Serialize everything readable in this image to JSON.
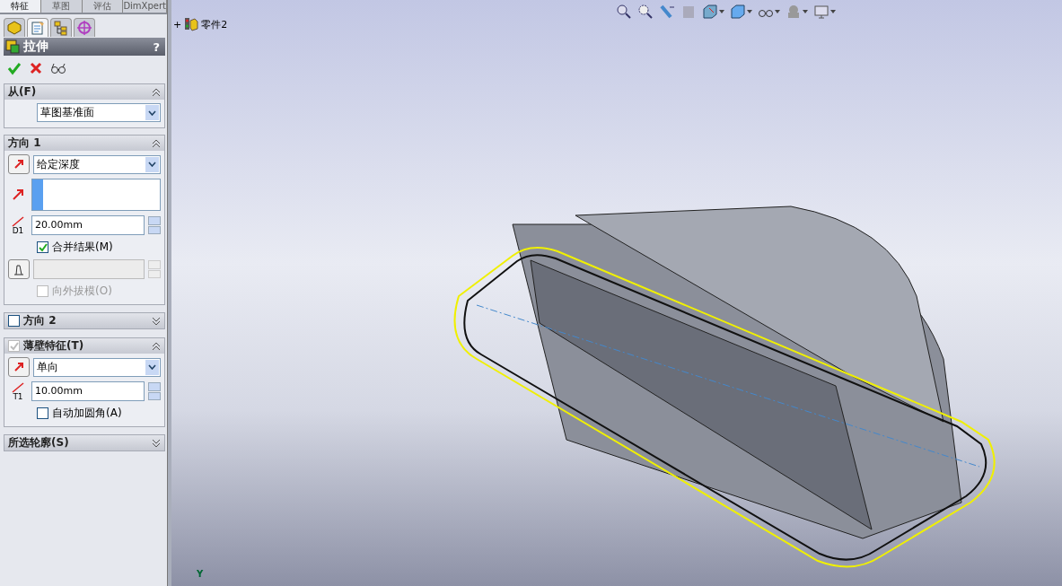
{
  "command_tabs": [
    {
      "label": "特征",
      "selected": true
    },
    {
      "label": "草图",
      "selected": false
    },
    {
      "label": "评估",
      "selected": false
    },
    {
      "label": "DimXpert",
      "selected": false
    }
  ],
  "manager_tabs": [
    {
      "kind": "feature",
      "selected": false
    },
    {
      "kind": "property",
      "selected": true
    },
    {
      "kind": "config",
      "selected": false
    },
    {
      "kind": "display",
      "selected": false
    }
  ],
  "property_manager": {
    "title": "拉伸",
    "help": "?"
  },
  "sections": [
    {
      "kind": "from",
      "title": "从(F)",
      "expanded": true,
      "start": "草图基准面"
    },
    {
      "kind": "direction",
      "title": "方向 1",
      "expanded": true,
      "end_condition": "给定深度",
      "depth_symbol": "D1",
      "depth": "20.00mm",
      "merge": {
        "label": "合并结果(M)",
        "checked": true,
        "disabled": false
      },
      "draft_outward": {
        "label": "向外拔模(O)",
        "checked": false,
        "disabled": true
      }
    },
    {
      "kind": "header_only",
      "title": "方向 2",
      "checked": false,
      "expanded": false
    },
    {
      "kind": "thin",
      "title": "薄壁特征(T)",
      "checked": true,
      "expanded": true,
      "type": "单向",
      "thickness_symbol": "T1",
      "thickness": "10.00mm",
      "auto_fillet": {
        "label": "自动加圆角(A)",
        "checked": false,
        "disabled": false
      }
    },
    {
      "kind": "header_only",
      "title": "所选轮廓(S)",
      "expanded": false
    }
  ],
  "tree": {
    "expander": "+",
    "label": "零件2"
  },
  "triad_label": "Y"
}
